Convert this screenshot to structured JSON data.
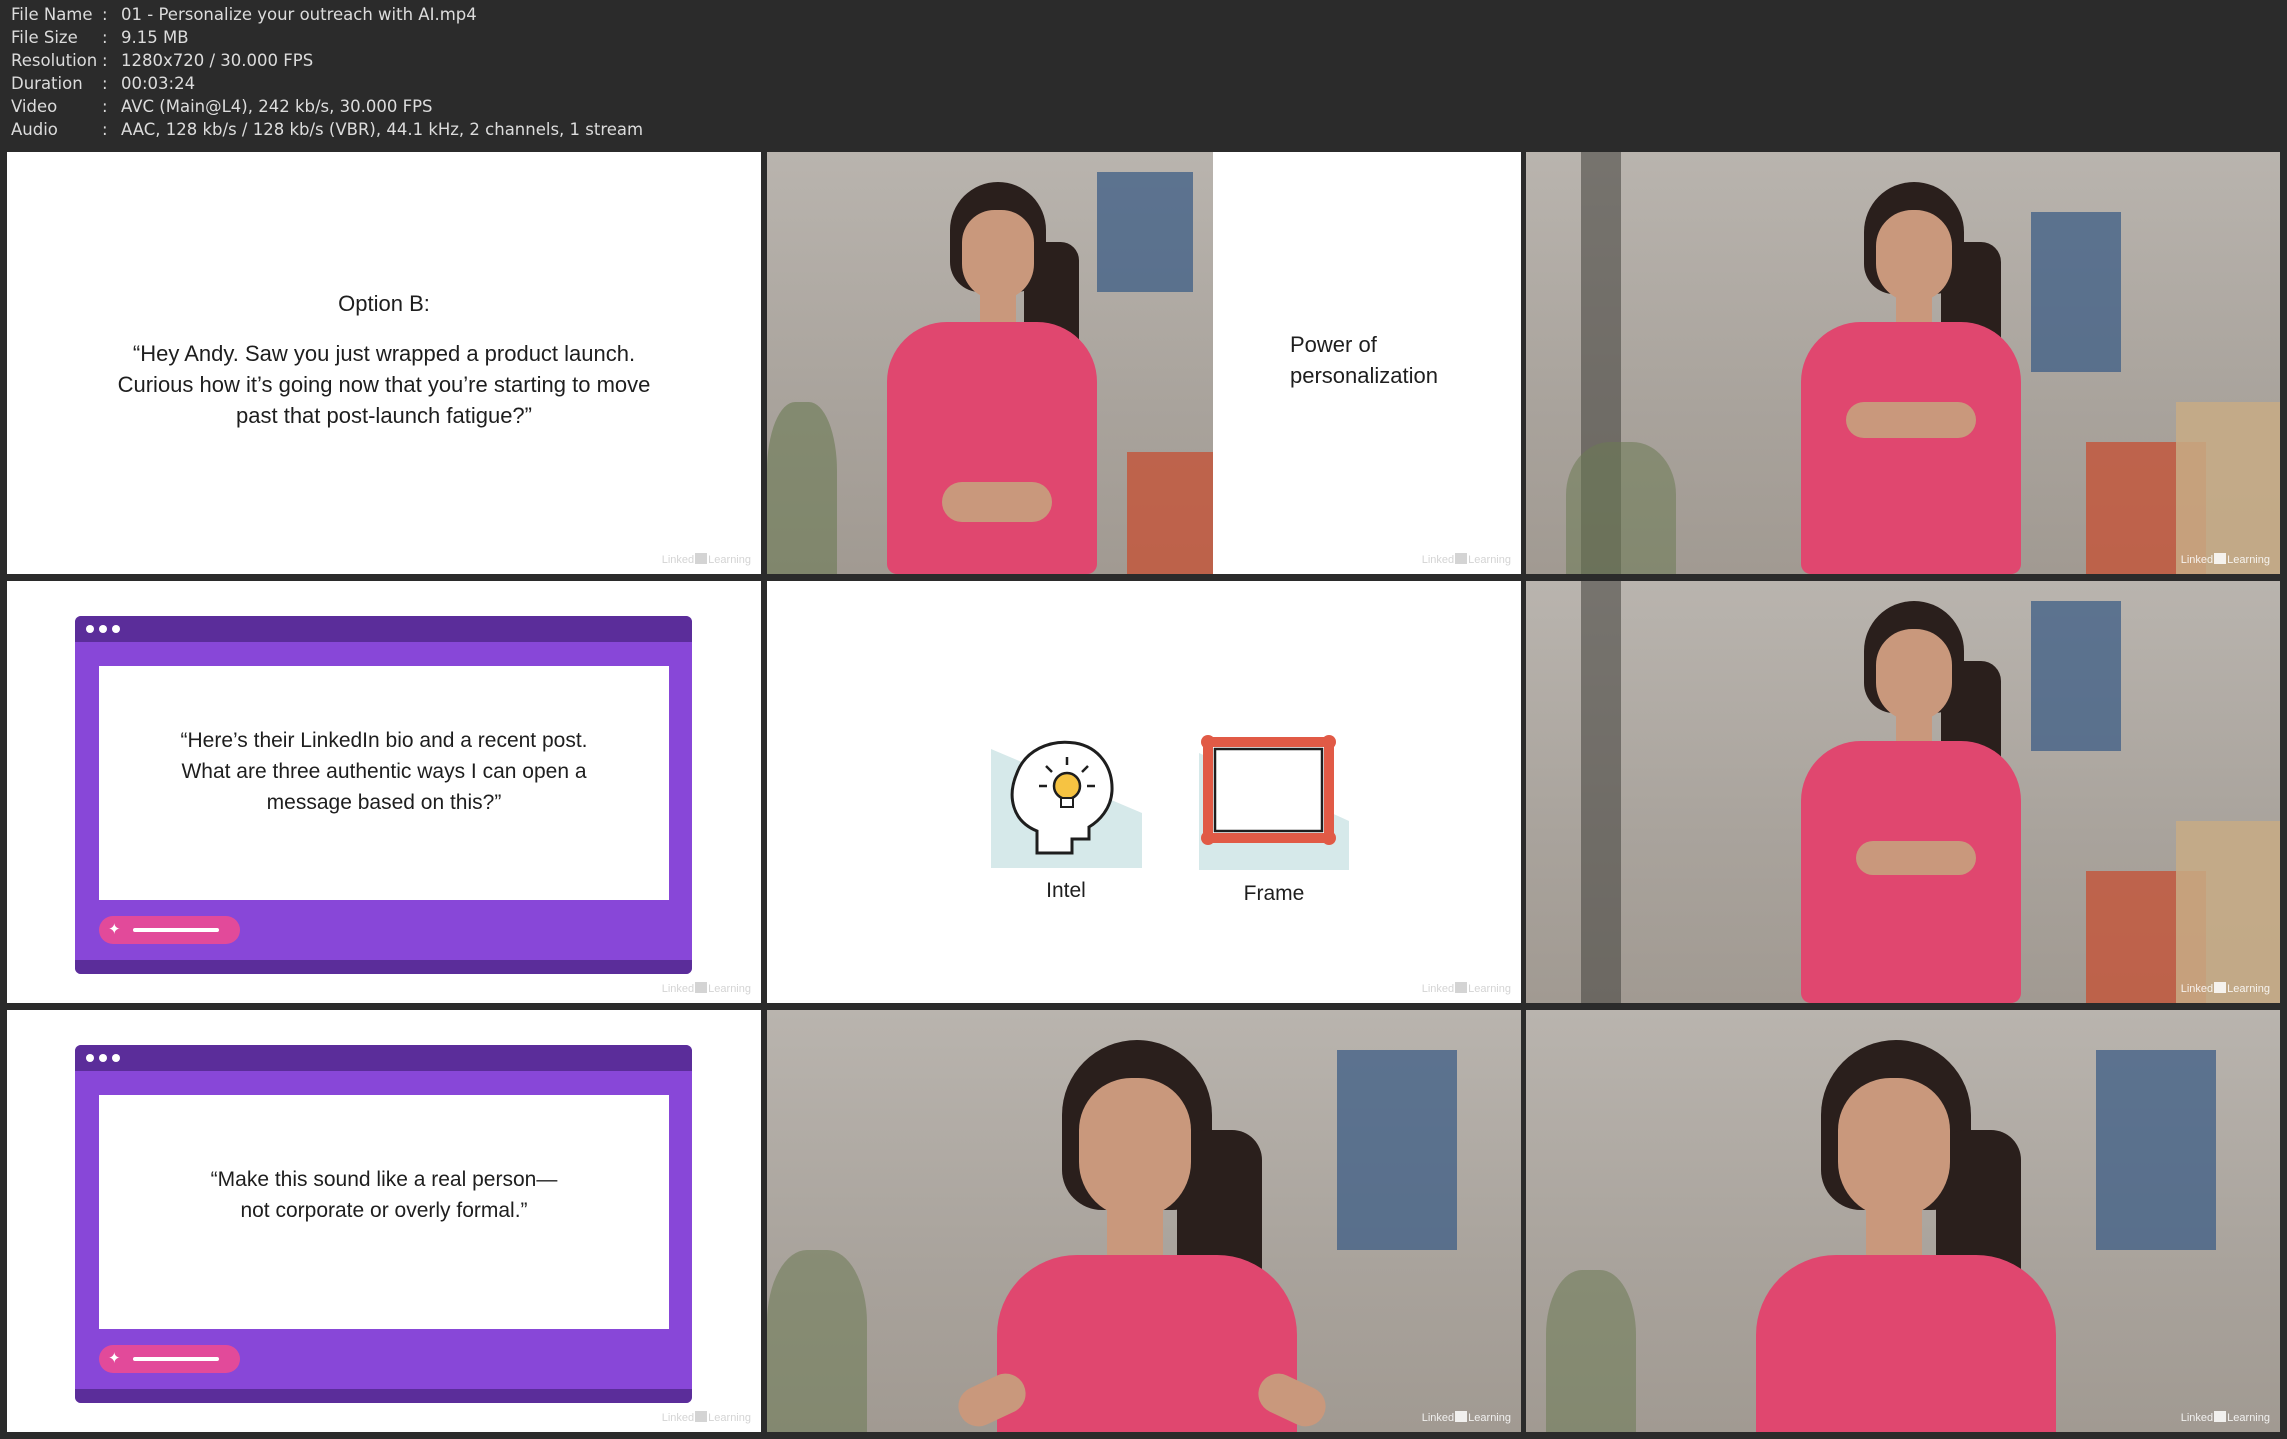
{
  "media_info": {
    "rows": [
      {
        "key": "File Name",
        "value": "01 - Personalize your outreach with AI.mp4"
      },
      {
        "key": "File Size",
        "value": "9.15 MB"
      },
      {
        "key": "Resolution",
        "value": "1280x720 / 30.000 FPS"
      },
      {
        "key": "Duration",
        "value": "00:03:24"
      },
      {
        "key": "Video",
        "value": "AVC (Main@L4), 242 kb/s, 30.000 FPS"
      },
      {
        "key": "Audio",
        "value": "AAC, 128 kb/s / 128 kb/s (VBR), 44.1 kHz, 2 channels, 1 stream"
      }
    ],
    "separator": ":"
  },
  "watermark": {
    "left": "Linked",
    "right": "Learning"
  },
  "thumbnails": {
    "t1": {
      "title": "Option B:",
      "lines": [
        "“Hey Andy. Saw you just wrapped a product launch.",
        "Curious how it’s going now that you’re starting to move",
        "past that post-launch fatigue?”"
      ]
    },
    "t2": {
      "lines": [
        "Power of",
        "personalization"
      ]
    },
    "t4": {
      "lines": [
        "“Here’s their LinkedIn bio and a recent post.",
        "What are three authentic ways I can open a",
        "message based on this?”"
      ]
    },
    "t5": {
      "labels": [
        "Intel",
        "Frame"
      ]
    },
    "t7": {
      "lines": [
        "“Make this sound like a real person—",
        "not corporate or overly formal.”"
      ]
    }
  },
  "colors": {
    "browser_purple": "#8847d8",
    "browser_dark": "#5b2d9a",
    "pill_pink": "#e24a9a",
    "dress_pink": "#e0476f",
    "frame_red": "#e15a46",
    "teal_bg": "#d6e9ea",
    "bulb_yellow": "#f6c342"
  },
  "icons": [
    "lightbulb-head-icon",
    "picture-frame-icon",
    "sparkle-icon"
  ]
}
